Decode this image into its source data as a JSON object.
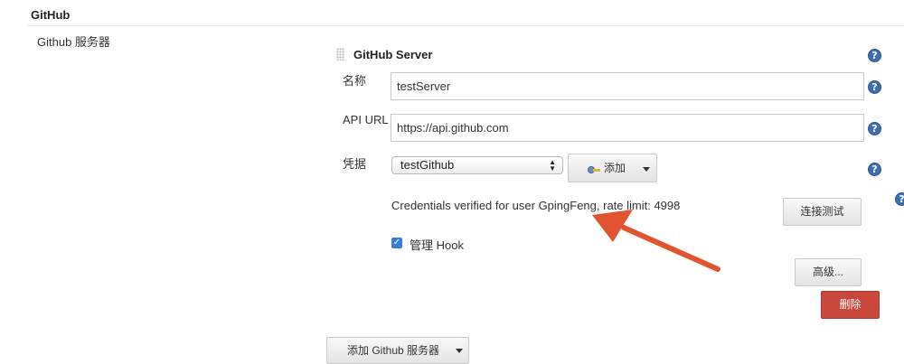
{
  "section": {
    "title": "GitHub",
    "row_label": "Github 服务器"
  },
  "server": {
    "title": "GitHub Server",
    "name_label": "名称",
    "name_value": "testServer",
    "api_url_label": "API URL",
    "api_url_value": "https://api.github.com",
    "credentials_label": "凭据",
    "credentials_selected": "testGithub",
    "add_button_label": "添加",
    "verification_text": "Credentials verified for user GpingFeng, rate limit: 4998",
    "test_connection_label": "连接测试",
    "manage_hook_checked": true,
    "manage_hook_label": "管理 Hook",
    "advanced_label": "高级...",
    "delete_label": "删除"
  },
  "footer": {
    "add_server_label": "添加 Github 服务器"
  },
  "icons": {
    "help": "help-icon",
    "key": "key-icon",
    "drag": "drag-handle-icon"
  },
  "colors": {
    "help_blue": "#3d6fae",
    "delete_red": "#c9473d",
    "checkbox_blue": "#3a7be0",
    "annotation_arrow": "#e0552f"
  }
}
